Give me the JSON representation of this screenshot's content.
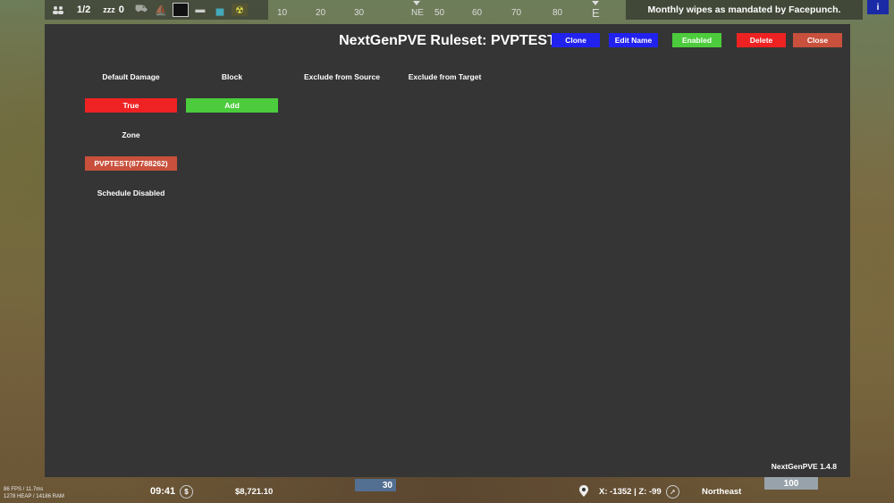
{
  "hud": {
    "team_count": "1/2",
    "sleep_label": "zzz",
    "sleep_count": "0",
    "notice": "Monthly wipes as mandated by Facepunch.",
    "info_button": "i"
  },
  "compass": {
    "ticks": [
      "10",
      "20",
      "30",
      "NE",
      "50",
      "60",
      "70",
      "80",
      "E"
    ]
  },
  "panel": {
    "title": "NextGenPVE Ruleset: PVPTEST",
    "buttons": {
      "clone": "Clone",
      "edit_name": "Edit Name",
      "enabled": "Enabled",
      "delete": "Delete",
      "close": "Close"
    },
    "columns": {
      "default_damage": "Default Damage",
      "block": "Block",
      "exclude_source": "Exclude from Source",
      "exclude_target": "Exclude from Target"
    },
    "default_damage_value": "True",
    "block_add": "Add",
    "zone_label": "Zone",
    "zone_value": "PVPTEST(87788262)",
    "schedule_status": "Schedule Disabled",
    "version": "NextGenPVE 1.4.8"
  },
  "bottom_hud": {
    "fps_line1": "86 FPS / 11.7ms",
    "fps_line2": "1278 HEAP / 14186 RAM",
    "time": "09:41",
    "money": "$8,721.10",
    "water": "30",
    "health": "100",
    "coords": "X: -1352 | Z: -99",
    "heading": "Northeast"
  },
  "colors": {
    "panel_bg": "#353535",
    "blue": "#2222ee",
    "green": "#4ccc3c",
    "red": "#ee2222",
    "rust_red": "#c8503c"
  }
}
